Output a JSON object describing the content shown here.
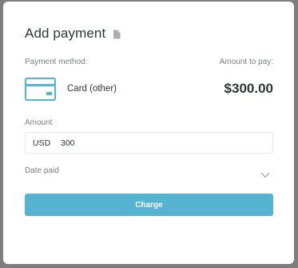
{
  "dialog": {
    "title": "Add payment",
    "title_icon": "document-icon"
  },
  "payment_method": {
    "label": "Payment method:",
    "icon": "credit-card-icon",
    "value": "Card (other)"
  },
  "amount_to_pay": {
    "label": "Amount to pay:",
    "value": "$300.00"
  },
  "amount": {
    "label": "Amount",
    "currency": "USD",
    "value": "300"
  },
  "date_paid": {
    "label": "Date paid",
    "icon": "chevron-down-icon"
  },
  "charge_button": {
    "label": "Charge"
  },
  "colors": {
    "accent": "#56b4d3",
    "text": "#2f3438",
    "muted": "#7a7f85",
    "backdrop": "#7e7e7e"
  }
}
